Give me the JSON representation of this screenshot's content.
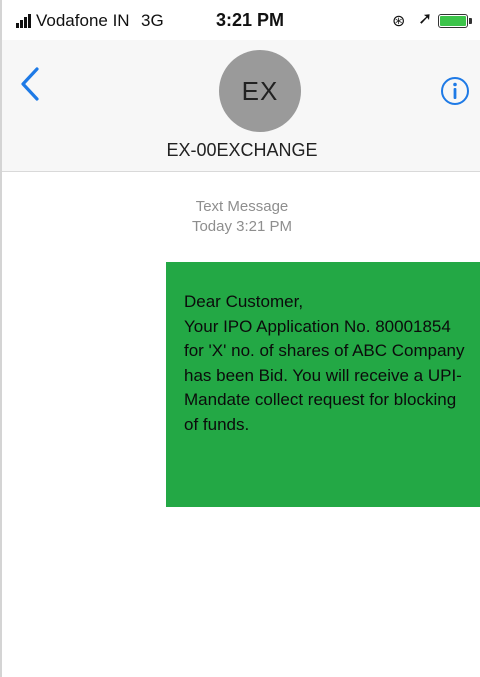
{
  "status_bar": {
    "carrier": "Vodafone IN",
    "network": "3G",
    "time": "3:21 PM",
    "icons": [
      "signal-icon",
      "rotation-lock-icon",
      "location-arrow-icon",
      "battery-icon"
    ],
    "battery_color": "#3cc44a"
  },
  "header": {
    "avatar_initials": "EX",
    "contact_name": "EX-00EXCHANGE",
    "back_icon": "chevron-left-icon",
    "info_icon": "info-icon",
    "accent_color": "#1e7ae6"
  },
  "conversation": {
    "meta_type": "Text Message",
    "meta_time": "Today 3:21 PM",
    "message": {
      "bubble_color": "#23a845",
      "greeting": "Dear Customer,",
      "body": "Your IPO Application No. 80001854 for 'X' no. of shares of ABC Company has been Bid. You will receive a UPI-Mandate collect request for blocking of funds."
    }
  }
}
